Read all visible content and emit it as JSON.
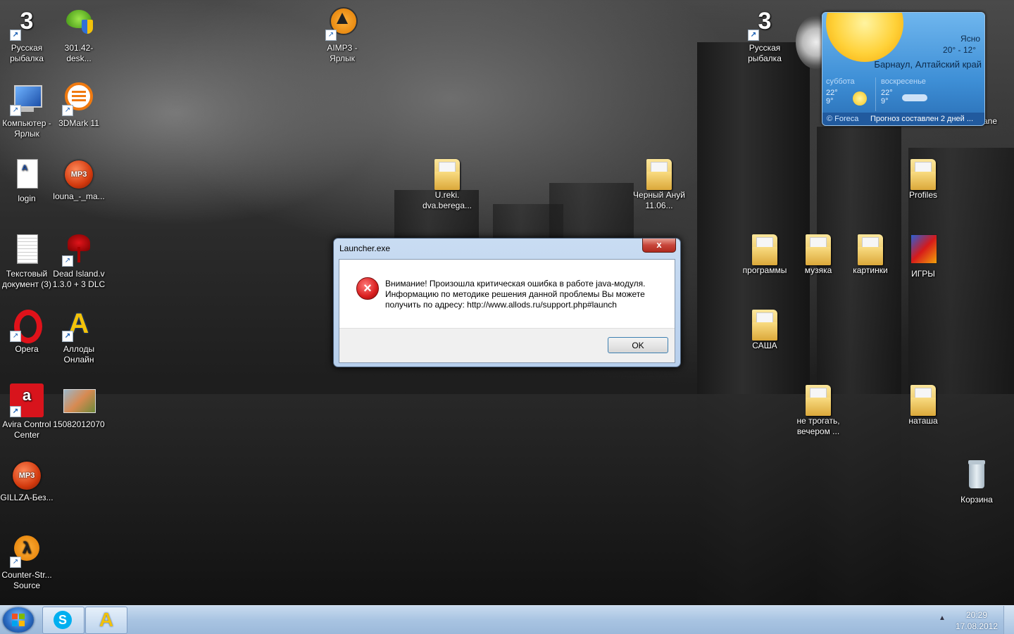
{
  "desktop_icons": [
    {
      "id": "rr-left",
      "label": "Русская рыбалка",
      "icon": "russian-fishing-icon"
    },
    {
      "id": "nvidia",
      "label": "301.42-desk...",
      "icon": "nvidia-installer-icon"
    },
    {
      "id": "aimp",
      "label": "AIMP3 - Ярлык",
      "icon": "aimp-icon"
    },
    {
      "id": "rr-right",
      "label": "Русская рыбалка",
      "icon": "russian-fishing-icon"
    },
    {
      "id": "computer",
      "label": "Компьютер - Ярлык",
      "icon": "computer-icon"
    },
    {
      "id": "3dmark",
      "label": "3DMark 11",
      "icon": "3dmark-icon"
    },
    {
      "id": "login",
      "label": "login",
      "icon": "document-icon"
    },
    {
      "id": "louna",
      "label": "louna_-_ma...",
      "icon": "mp3-icon"
    },
    {
      "id": "ureki",
      "label": "U.reki. dva.berega...",
      "icon": "folder-icon"
    },
    {
      "id": "cherny",
      "label": "Черный Ануй 11.06...",
      "icon": "folder-icon"
    },
    {
      "id": "profiles",
      "label": "Profiles",
      "icon": "folder-icon"
    },
    {
      "id": "txtdoc",
      "label": "Текстовый документ (3)",
      "icon": "text-document-icon"
    },
    {
      "id": "deadisland",
      "label": "Dead Island.v 1.3.0 + 3 DLC",
      "icon": "dead-island-icon"
    },
    {
      "id": "programmy",
      "label": "программы",
      "icon": "folder-icon"
    },
    {
      "id": "muzyka",
      "label": "музяка",
      "icon": "folder-icon"
    },
    {
      "id": "kartinki",
      "label": "картинки",
      "icon": "folder-icon"
    },
    {
      "id": "igry",
      "label": "ИГРЫ",
      "icon": "games-icon"
    },
    {
      "id": "opera",
      "label": "Opera",
      "icon": "opera-icon"
    },
    {
      "id": "allods",
      "label": "Аллоды Онлайн",
      "icon": "allods-icon"
    },
    {
      "id": "sasha",
      "label": "САША",
      "icon": "folder-icon"
    },
    {
      "id": "avira",
      "label": "Avira Control Center",
      "icon": "avira-icon"
    },
    {
      "id": "photo",
      "label": "15082012070",
      "icon": "photo-icon"
    },
    {
      "id": "netrogat",
      "label": "не трогать, вечером ...",
      "icon": "folder-icon"
    },
    {
      "id": "natasha",
      "label": "наташа",
      "icon": "folder-icon"
    },
    {
      "id": "gillza",
      "label": "GILLZA-Без...",
      "icon": "mp3-icon"
    },
    {
      "id": "korzina",
      "label": "Корзина",
      "icon": "recycle-bin-icon"
    },
    {
      "id": "counter",
      "label": "Counter-Str... Source",
      "icon": "counter-strike-icon"
    },
    {
      "id": "pavane",
      "label": "e - Pavane",
      "icon": "mp3-icon"
    }
  ],
  "weather": {
    "condition": "Ясно",
    "temps": "20°  -  12°",
    "city": "Барнаул, Алтайский край",
    "days": [
      {
        "name": "суббота",
        "high": "22°",
        "low": "9°",
        "icon": "sun-icon"
      },
      {
        "name": "воскресенье",
        "high": "22°",
        "low": "9°",
        "icon": "cloud-icon"
      }
    ],
    "brand": "© Foreca",
    "forecast_note": "Прогноз составлен 2 дней ..."
  },
  "dialog": {
    "title": "Launcher.exe",
    "close_label": "x",
    "message": "Внимание! Произошла критическая ошибка в работе java-модуля. Информацию по методике решения данной проблемы Вы можете получить по адресу: http://www.allods.ru/support.php#launch",
    "ok_label": "OK",
    "icon": "error-icon"
  },
  "taskbar": {
    "time": "20:29",
    "date": "17.08.2012",
    "pinned": [
      {
        "id": "skype",
        "icon": "skype-icon"
      },
      {
        "id": "allods",
        "icon": "allods-icon"
      }
    ]
  },
  "colors": {
    "taskbar": "#a9c4e2",
    "dialog_frame": "#b7cfec",
    "error_red": "#d81e1e"
  }
}
